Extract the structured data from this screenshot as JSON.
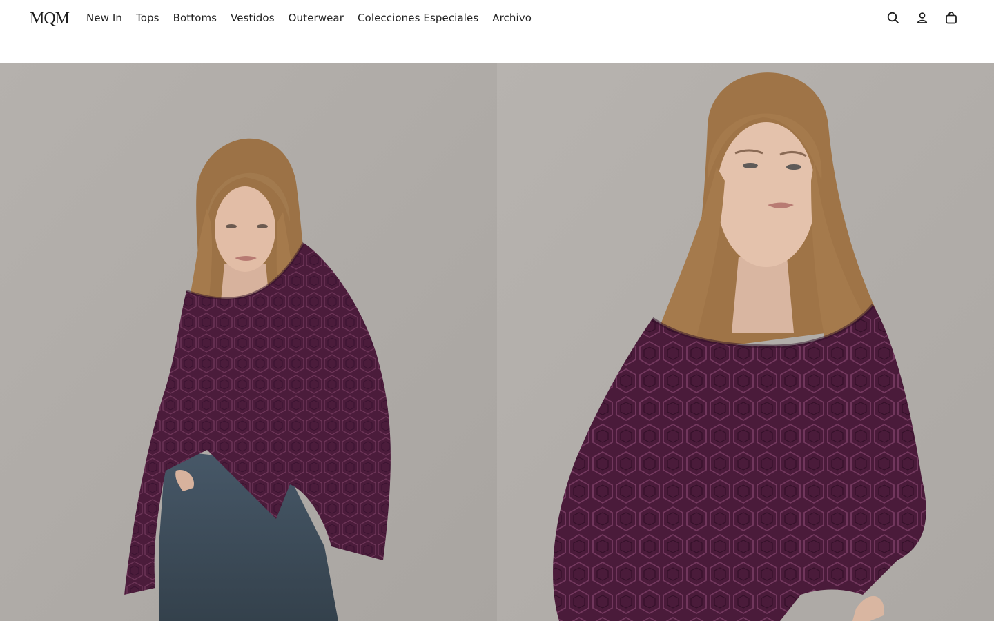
{
  "brand": {
    "name": "MQM",
    "logo_text": "MQM"
  },
  "nav": {
    "items": [
      {
        "label": "New In"
      },
      {
        "label": "Tops"
      },
      {
        "label": "Bottoms"
      },
      {
        "label": "Vestidos"
      },
      {
        "label": "Outerwear"
      },
      {
        "label": "Colecciones Especiales"
      },
      {
        "label": "Archivo"
      }
    ]
  },
  "header_icons": [
    "search-icon",
    "account-icon",
    "cart-icon"
  ],
  "gallery": {
    "images": [
      {
        "subject": "model wearing plum knit poncho with jeans, full body"
      },
      {
        "subject": "model wearing plum knit poncho, close-up"
      }
    ]
  },
  "colors": {
    "background": "#ffffff",
    "text": "#222222",
    "garment": "#4a1b3a",
    "backdrop": "#b3afab",
    "hair": "#a57a4c",
    "denim": "#3b4a56"
  }
}
